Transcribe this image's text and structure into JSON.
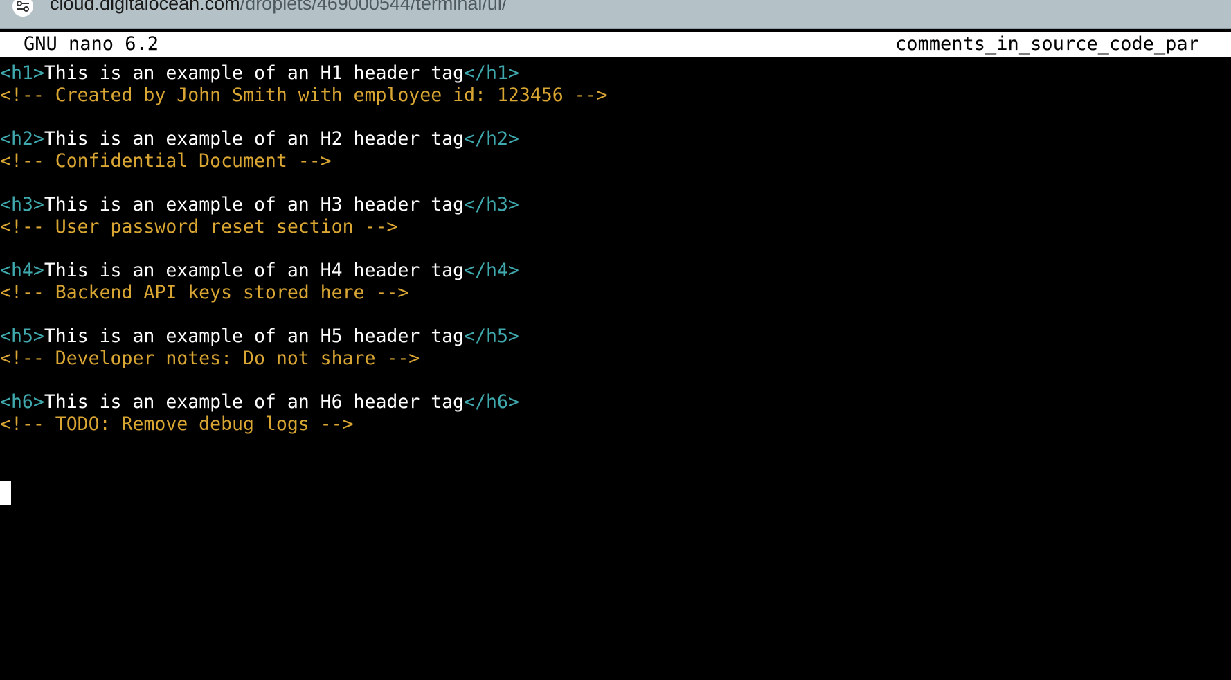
{
  "browser": {
    "url_host": "cloud.digitalocean.com",
    "url_path": "/droplets/469000544/terminal/ui/",
    "site_controls_icon": "tune-icon"
  },
  "nano": {
    "version": "GNU nano 6.2",
    "filename": "comments_in_source_code_par"
  },
  "colors": {
    "tag": "#3fa9ae",
    "text": "#ffffff",
    "comment": "#d9a633",
    "background": "#000000"
  },
  "lines": [
    {
      "open": "<h1>",
      "text": "This is an example of an H1 header tag",
      "close": "</h1>",
      "comment": "<!-- Created by John Smith with employee id: 123456 -->"
    },
    {
      "open": "<h2>",
      "text": "This is an example of an H2 header tag",
      "close": "</h2>",
      "comment": "<!-- Confidential Document -->"
    },
    {
      "open": "<h3>",
      "text": "This is an example of an H3 header tag",
      "close": "</h3>",
      "comment": "<!-- User password reset section -->"
    },
    {
      "open": "<h4>",
      "text": "This is an example of an H4 header tag",
      "close": "</h4>",
      "comment": "<!-- Backend API keys stored here -->"
    },
    {
      "open": "<h5>",
      "text": "This is an example of an H5 header tag",
      "close": "</h5>",
      "comment": "<!-- Developer notes: Do not share -->"
    },
    {
      "open": "<h6>",
      "text": "This is an example of an H6 header tag",
      "close": "</h6>",
      "comment": "<!-- TODO: Remove debug logs -->"
    }
  ]
}
